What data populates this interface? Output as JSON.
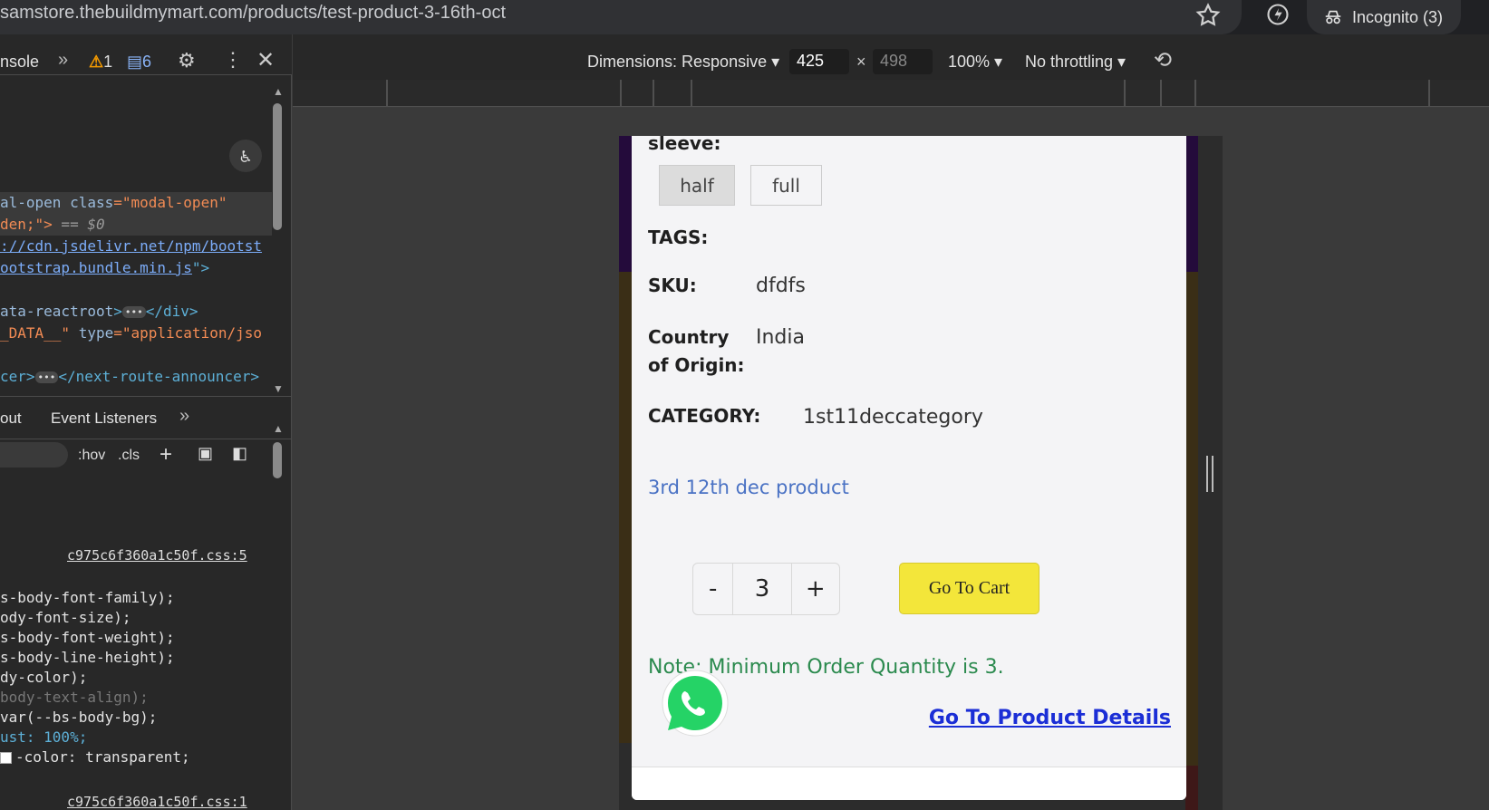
{
  "browser": {
    "url": "samstore.thebuildmymart.com/products/test-product-3-16th-oct",
    "incognito_label": "Incognito (3)"
  },
  "devtools": {
    "tab_label": "nsole",
    "warn_count": "1",
    "msg_count": "6",
    "elements_lines": [
      {
        "a": "al-open ",
        "b": "class",
        "c": "=\"modal-open\""
      },
      {
        "a": "den;\">",
        "b": " == ",
        "c": "$0"
      },
      {
        "a": "://cdn.jsdelivr.net/npm/bootst"
      },
      {
        "a": "ootstrap.bundle.min.js",
        "b": "\">"
      },
      {
        "a": "ata-reactroot",
        "b": ">",
        "c": "</div>"
      },
      {
        "a": "_DATA__\" ",
        "b": "type",
        "c": "=\"application/jso"
      },
      {
        "a": "cer>",
        "b": "</next-route-announcer>"
      }
    ],
    "styles_tab_1": "out",
    "styles_tab_2": "Event Listeners",
    "hov": ":hov",
    "cls": ".cls",
    "css_source": "c975c6f360a1c50f.css:5",
    "css_source_2": "c975c6f360a1c50f.css:1",
    "css_lines": [
      "s-body-font-family);",
      "ody-font-size);",
      "s-body-font-weight);",
      "s-body-line-height);",
      "dy-color);",
      "body-text-align);",
      "var(--bs-body-bg);",
      "ust: 100%;",
      "-color: transparent;"
    ]
  },
  "device_toolbar": {
    "dimensions_label": "Dimensions: Responsive ▾",
    "width": "425",
    "height": "498",
    "zoom": "100% ▾",
    "throttle": "No throttling ▾"
  },
  "product": {
    "sleeve_label": "sleeve:",
    "sleeve_options": [
      "half",
      "full"
    ],
    "tags_label": "TAGS:",
    "sku_label": "SKU:",
    "sku_value": "dfdfs",
    "origin_label_1": "Country",
    "origin_label_2": "of Origin:",
    "origin_value": "India",
    "category_label": "CATEGORY:",
    "category_value": "1st11deccategory",
    "product_link": "3rd 12th dec product",
    "qty_minus": "-",
    "qty_value": "3",
    "qty_plus": "+",
    "cart_button": "Go To Cart",
    "note": "Note: Minimum Order Quantity is 3.",
    "details_link": "Go To Product Details"
  },
  "colors": {
    "cart_button": "#f3e63a",
    "note": "#2b8a4e",
    "details_link": "#1b2ed6",
    "product_link": "#4a72c4"
  }
}
